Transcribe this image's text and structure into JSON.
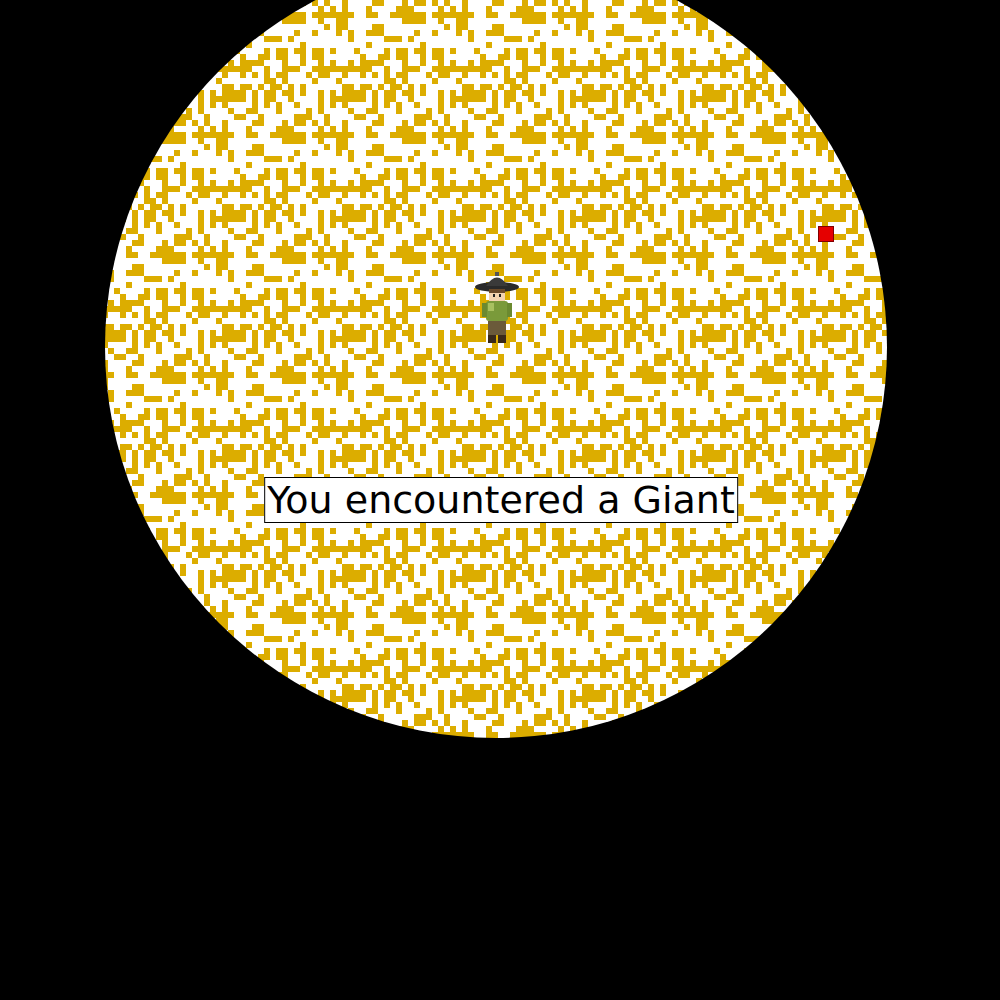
{
  "message": "You encountered a Giant"
}
